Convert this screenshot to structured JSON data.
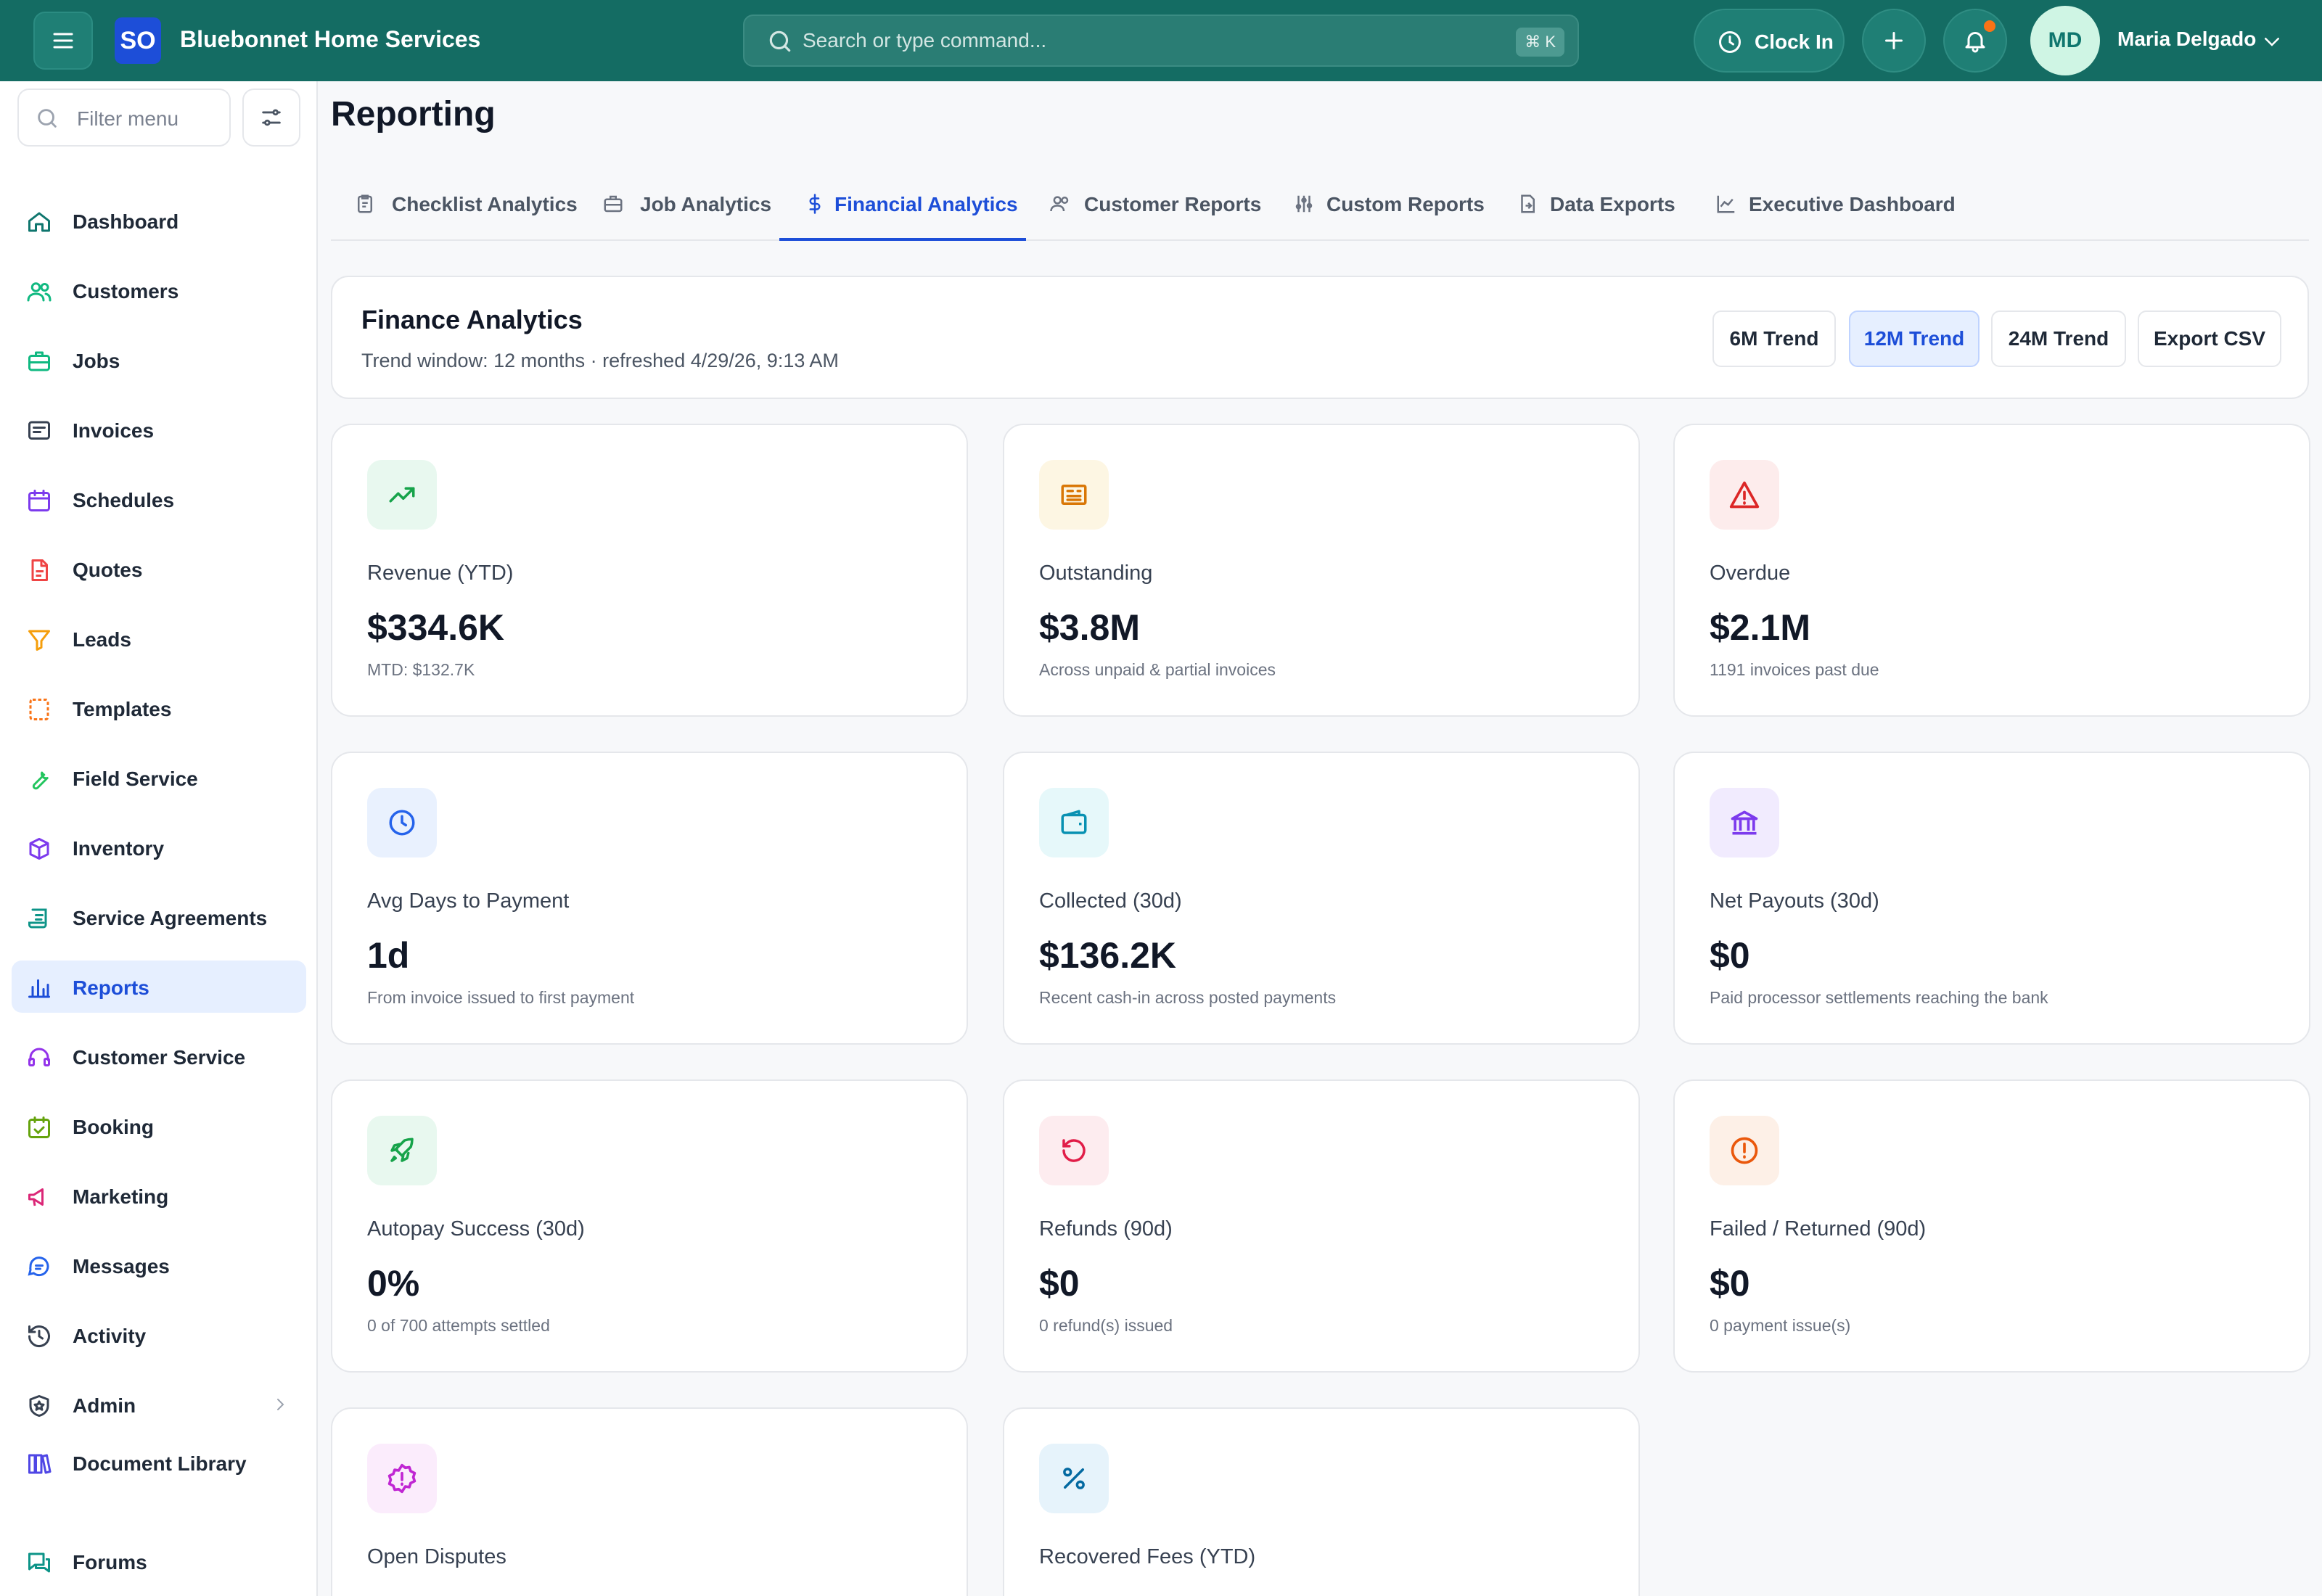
{
  "app": {
    "logo_text": "SO",
    "brand": "Bluebonnet Home Services",
    "search_placeholder": "Search or type command...",
    "search_shortcut": "⌘ K",
    "clock_in_label": "Clock In",
    "user_initials": "MD",
    "user_name": "Maria Delgado",
    "notification_dot_color": "#f97316",
    "topbar_color": "#146c63",
    "accent_color": "#1d4ed8"
  },
  "sidebar": {
    "filter_placeholder": "Filter menu",
    "items": [
      {
        "label": "Dashboard",
        "icon": "home-icon",
        "color": "#0f766e"
      },
      {
        "label": "Customers",
        "icon": "users-icon",
        "color": "#10b981"
      },
      {
        "label": "Jobs",
        "icon": "briefcase-icon",
        "color": "#10b981"
      },
      {
        "label": "Invoices",
        "icon": "invoice-icon",
        "color": "#374151"
      },
      {
        "label": "Schedules",
        "icon": "calendar-icon",
        "color": "#7c3aed"
      },
      {
        "label": "Quotes",
        "icon": "document-icon",
        "color": "#ef4444"
      },
      {
        "label": "Leads",
        "icon": "funnel-icon",
        "color": "#f59e0b"
      },
      {
        "label": "Templates",
        "icon": "template-icon",
        "color": "#f97316"
      },
      {
        "label": "Field Service",
        "icon": "wrench-icon",
        "color": "#22c55e"
      },
      {
        "label": "Inventory",
        "icon": "box-icon",
        "color": "#7c3aed"
      },
      {
        "label": "Service Agreements",
        "icon": "scroll-icon",
        "color": "#0d9488"
      },
      {
        "label": "Reports",
        "icon": "bar-chart-icon",
        "color": "#1d4ed8",
        "active": true
      },
      {
        "label": "Customer Service",
        "icon": "headset-icon",
        "color": "#9333ea"
      },
      {
        "label": "Booking",
        "icon": "calendar-check-icon",
        "color": "#65a30d"
      },
      {
        "label": "Marketing",
        "icon": "megaphone-icon",
        "color": "#db2777"
      },
      {
        "label": "Messages",
        "icon": "chat-icon",
        "color": "#2563eb"
      },
      {
        "label": "Activity",
        "icon": "history-icon",
        "color": "#374151"
      },
      {
        "label": "Admin",
        "icon": "shield-star-icon",
        "color": "#374151",
        "has_submenu": true
      },
      {
        "label": "Document Library",
        "icon": "library-icon",
        "color": "#4f46e5"
      },
      {
        "label": "Forums",
        "icon": "forum-icon",
        "color": "#0d9488"
      }
    ]
  },
  "page": {
    "title": "Reporting",
    "tabs": [
      {
        "label": "Checklist Analytics",
        "icon": "clipboard-icon"
      },
      {
        "label": "Job Analytics",
        "icon": "briefcase-icon"
      },
      {
        "label": "Financial Analytics",
        "icon": "dollar-icon",
        "active": true
      },
      {
        "label": "Customer Reports",
        "icon": "users-icon"
      },
      {
        "label": "Custom Reports",
        "icon": "sliders-icon"
      },
      {
        "label": "Data Exports",
        "icon": "file-export-icon"
      },
      {
        "label": "Executive Dashboard",
        "icon": "line-chart-icon"
      }
    ]
  },
  "finance": {
    "title": "Finance Analytics",
    "subtitle": "Trend window: 12 months · refreshed 4/29/26, 9:13 AM",
    "buttons": [
      "6M Trend",
      "12M Trend",
      "24M Trend",
      "Export CSV"
    ],
    "active_button": "12M Trend"
  },
  "metrics": [
    {
      "label": "Revenue (YTD)",
      "value": "$334.6K",
      "note": "MTD: $132.7K",
      "icon": "trending-up-icon",
      "color": "#16a34a",
      "bg": "#e8f8ef"
    },
    {
      "label": "Outstanding",
      "value": "$3.8M",
      "note": "Across unpaid & partial invoices",
      "icon": "receipt-icon",
      "color": "#d97706",
      "bg": "#fdf6e3"
    },
    {
      "label": "Overdue",
      "value": "$2.1M",
      "note": "1191 invoices past due",
      "icon": "alert-triangle-icon",
      "color": "#dc2626",
      "bg": "#fdecec"
    },
    {
      "label": "Avg Days to Payment",
      "value": "1d",
      "note": "From invoice issued to first payment",
      "icon": "clock-icon",
      "color": "#2563eb",
      "bg": "#e9f1fe"
    },
    {
      "label": "Collected (30d)",
      "value": "$136.2K",
      "note": "Recent cash-in across posted payments",
      "icon": "wallet-icon",
      "color": "#0891b2",
      "bg": "#e6f8fa"
    },
    {
      "label": "Net Payouts (30d)",
      "value": "$0",
      "note": "Paid processor settlements reaching the bank",
      "icon": "bank-icon",
      "color": "#7c3aed",
      "bg": "#f1ebfe"
    },
    {
      "label": "Autopay Success (30d)",
      "value": "0%",
      "note": "0 of 700 attempts settled",
      "icon": "rocket-icon",
      "color": "#16a34a",
      "bg": "#e8f8ef"
    },
    {
      "label": "Refunds (90d)",
      "value": "$0",
      "note": "0 refund(s) issued",
      "icon": "rotate-ccw-icon",
      "color": "#e11d48",
      "bg": "#fdecef"
    },
    {
      "label": "Failed / Returned (90d)",
      "value": "$0",
      "note": "0 payment issue(s)",
      "icon": "alert-octagon-icon",
      "color": "#ea580c",
      "bg": "#fdf0e7"
    },
    {
      "label": "Open Disputes",
      "value": "",
      "note": "",
      "icon": "badge-alert-icon",
      "color": "#c026d3",
      "bg": "#fbecfc"
    },
    {
      "label": "Recovered Fees (YTD)",
      "value": "",
      "note": "",
      "icon": "percent-icon",
      "color": "#0369a1",
      "bg": "#e6f3fb"
    }
  ]
}
